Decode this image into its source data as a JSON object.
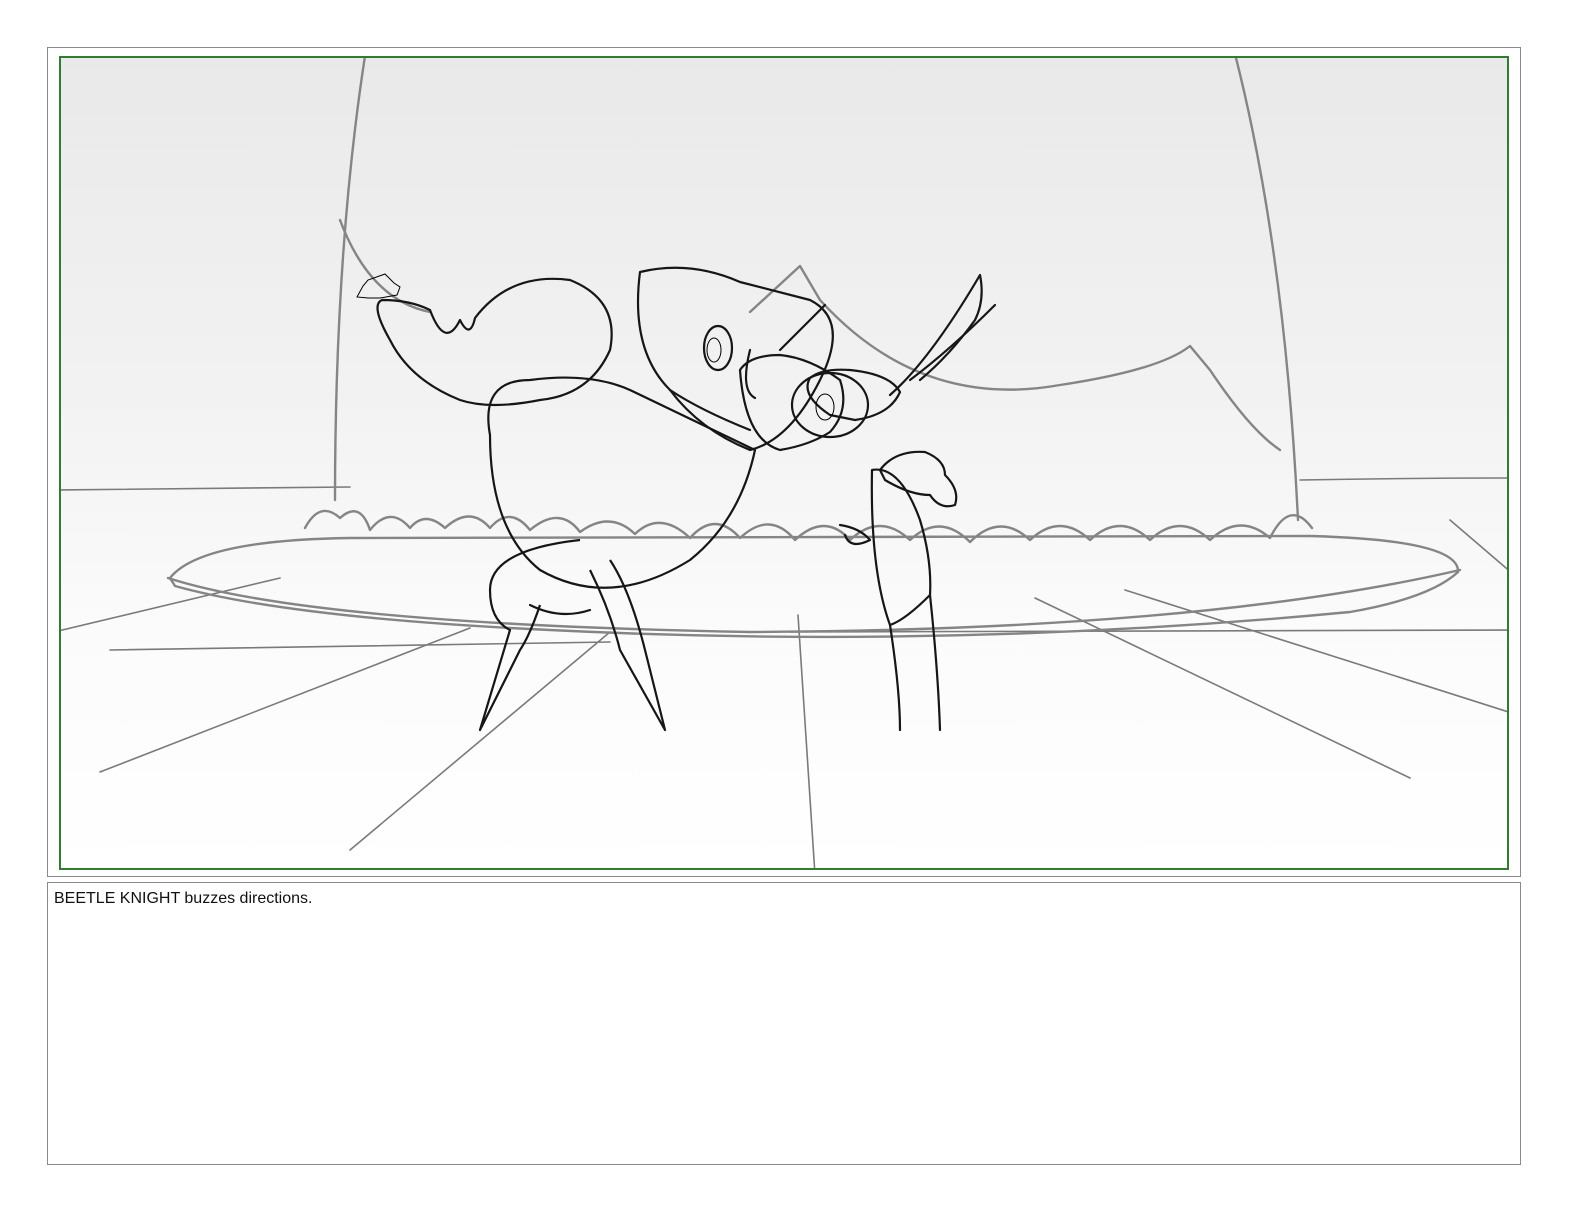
{
  "storyboard": {
    "panel": {
      "image_description_icon": "storyboard-sketch"
    },
    "notes": {
      "action_text": "BEETLE KNIGHT buzzes directions."
    }
  }
}
